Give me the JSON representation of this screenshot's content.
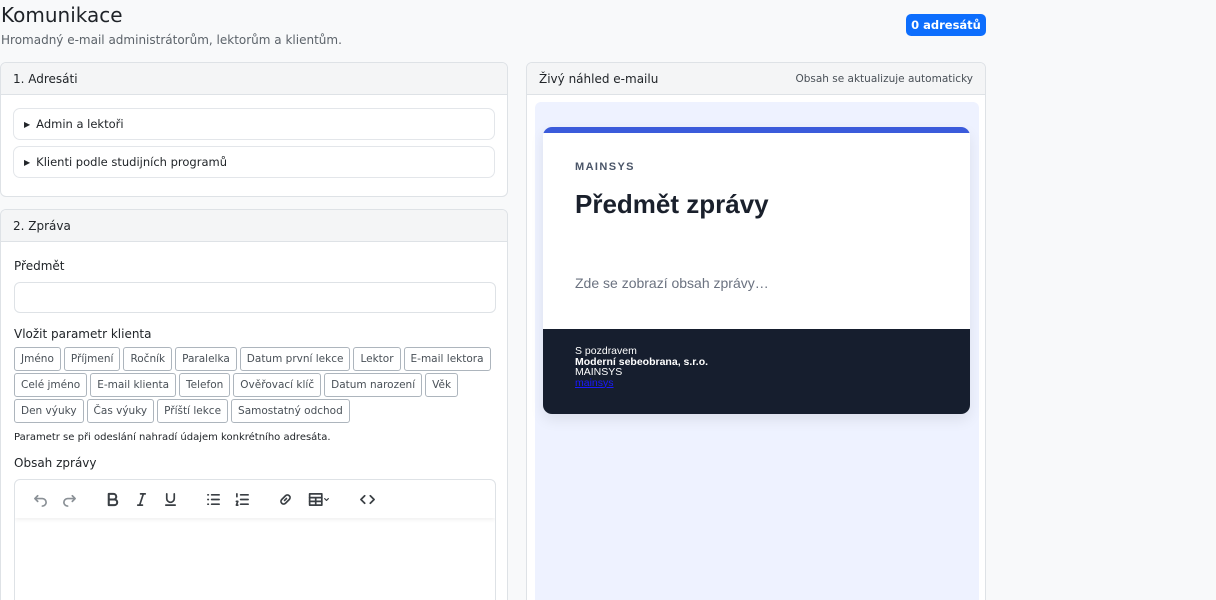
{
  "header": {
    "title": "Komunikace",
    "subtitle": "Hromadný e-mail administrátorům, lektorům a klientům.",
    "recipients_badge": "0 adresátů",
    "badge_color": "#0d6efd"
  },
  "recipients": {
    "title": "1. Adresáti",
    "groups": [
      "Admin a lektoři",
      "Klienti podle studijních programů"
    ]
  },
  "message": {
    "title": "2. Zpráva",
    "subject_label": "Předmět",
    "subject_value": "",
    "params_label": "Vložit parametr klienta",
    "params": [
      "Jméno",
      "Příjmení",
      "Ročník",
      "Paralelka",
      "Datum první lekce",
      "Lektor",
      "E-mail lektora",
      "Celé jméno",
      "E-mail klienta",
      "Telefon",
      "Ověřovací klíč",
      "Datum narození",
      "Věk",
      "Den výuky",
      "Čas výuky",
      "Příští lekce",
      "Samostatný odchod"
    ],
    "params_hint": "Parametr se při odeslání nahradí údajem konkrétního adresáta.",
    "body_label": "Obsah zprávy",
    "toolbar": [
      "undo-icon",
      "redo-icon",
      "bold-icon",
      "italic-icon",
      "underline-icon",
      "bullet-list-icon",
      "numbered-list-icon",
      "link-icon",
      "table-icon",
      "code-icon"
    ]
  },
  "preview": {
    "title": "Živý náhled e-mailu",
    "note": "Obsah se aktualizuje automaticky",
    "brand": "MAINSYS",
    "subject": "Předmět zprávy",
    "body": "Zde se zobrazí obsah zprávy…",
    "footer": {
      "greeting": "S pozdravem",
      "company": "Moderní sebeobrana, s.r.o.",
      "system": "MAINSYS",
      "link": "mainsys"
    },
    "accent_color": "#3b5bdb"
  }
}
